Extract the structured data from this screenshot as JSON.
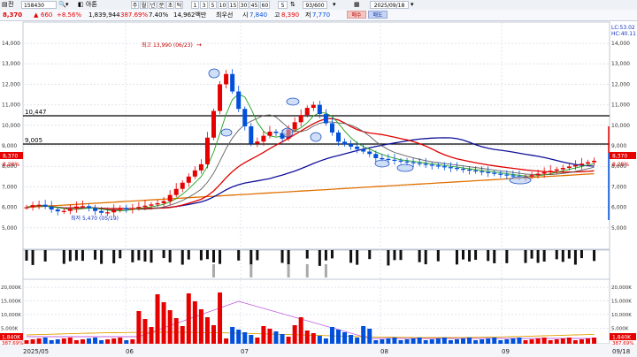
{
  "toolbar": {
    "market_label": "전",
    "code": "158430",
    "name": "아톤",
    "periods": [
      "주",
      "월",
      "년",
      "분",
      "초",
      "틱"
    ],
    "intervals": [
      "1",
      "3",
      "5",
      "10",
      "15",
      "30",
      "45",
      "60"
    ],
    "extra": "5",
    "counter": "93/600",
    "date": "2025/09/18"
  },
  "quote": {
    "price": "8,370",
    "change": "660",
    "change_pct": "+8.56%",
    "volume": "1,839,944",
    "vol_ratio": "387.69%",
    "turnover_rate": "7.40%",
    "trade_value": "14,962백만",
    "priority": "최우선",
    "open_label": "시",
    "open": "7,840",
    "high_label": "고",
    "high": "8,390",
    "low_label": "저",
    "low": "7,770",
    "buy_label": "매수",
    "sell_label": "매도"
  },
  "chart": {
    "high_annotation": "최고 13,990 (06/23)",
    "low_annotation": "최저 5,470 (05/19)",
    "hline1": "10,447",
    "hline2": "9,005",
    "legend_lc": "LC:53.02",
    "legend_hc": "HC:40.11",
    "price_axis": [
      "14,000",
      "13,000",
      "12,000",
      "11,000",
      "10,000",
      "9,000",
      "8,000",
      "7,000",
      "6,000",
      "5,000"
    ],
    "left_price_tag": "8,370",
    "left_price_tag2": "8,28%",
    "right_price_tag": "8,370",
    "right_price_tag2": "8,28%",
    "volume_axis": [
      "20,000K",
      "15,000K",
      "10,000K",
      "5,000K"
    ],
    "left_vol_tag": "1,840K",
    "left_vol_tag2": "387.69%",
    "right_vol_tag": "1,840K",
    "right_vol_tag2": "387.69%",
    "date_labels": [
      "2025/05",
      "06",
      "07",
      "08",
      "09",
      "09/18"
    ]
  },
  "colors": {
    "up": "#e60000",
    "down": "#0050dc",
    "ma5": "#1aa01a",
    "ma20": "#e00000",
    "ma60": "#10109a",
    "ma120": "#e07000"
  }
}
